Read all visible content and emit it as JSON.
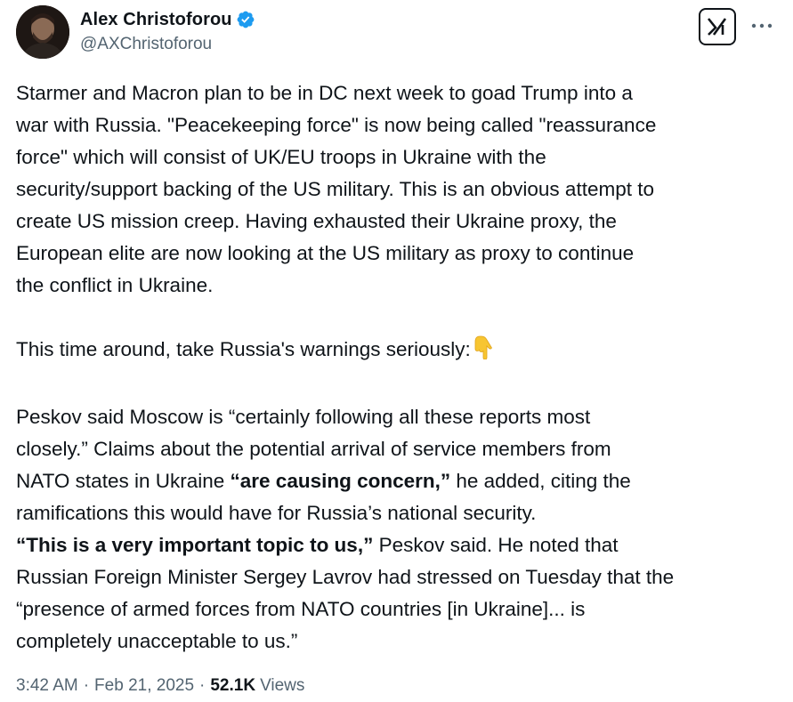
{
  "author": {
    "display_name": "Alex Christoforou",
    "handle": "@AXChristoforou",
    "verified_color": "#1d9bf0"
  },
  "actions": {
    "grok_icon": "grok-icon",
    "more_icon": "more-dots-icon"
  },
  "post": {
    "p1_lines": [
      "Starmer and Macron plan to be in DC next week to goad Trump into a",
      "war with Russia. \"Peacekeeping force\" is now being called \"reassurance",
      "force\" which will consist of UK/EU troops in Ukraine with the",
      "security/support backing of the US military. This is an obvious attempt to",
      "create US mission creep. Having exhausted their Ukraine proxy, the",
      "European elite are now looking at the US military as proxy to continue",
      "the conflict in Ukraine."
    ],
    "p2": "This time around, take Russia's warnings seriously:",
    "p2_emoji": "👇",
    "p3_line1": "Peskov said Moscow is “certainly following all these reports most",
    "p3_line2": "closely.” Claims about the potential arrival of service members from",
    "p3_line3_pre": "NATO states in Ukraine ",
    "p3_line3_bold": "“are causing concern,”",
    "p3_line3_post": " he added, citing the",
    "p3_line4": "ramifications this would have for Russia’s national security.",
    "p3_line5_bold": "“This is a very important topic to us,”",
    "p3_line5_post": " Peskov said. He noted that",
    "p3_line6": "Russian Foreign Minister Sergey Lavrov had stressed on Tuesday that the",
    "p3_line7": "“presence of armed forces from NATO countries [in Ukraine]... is",
    "p3_line8": "completely unacceptable to us.”"
  },
  "meta": {
    "time": "3:42 AM",
    "separator": "·",
    "date": "Feb 21, 2025",
    "views_count": "52.1K",
    "views_label": "Views"
  }
}
